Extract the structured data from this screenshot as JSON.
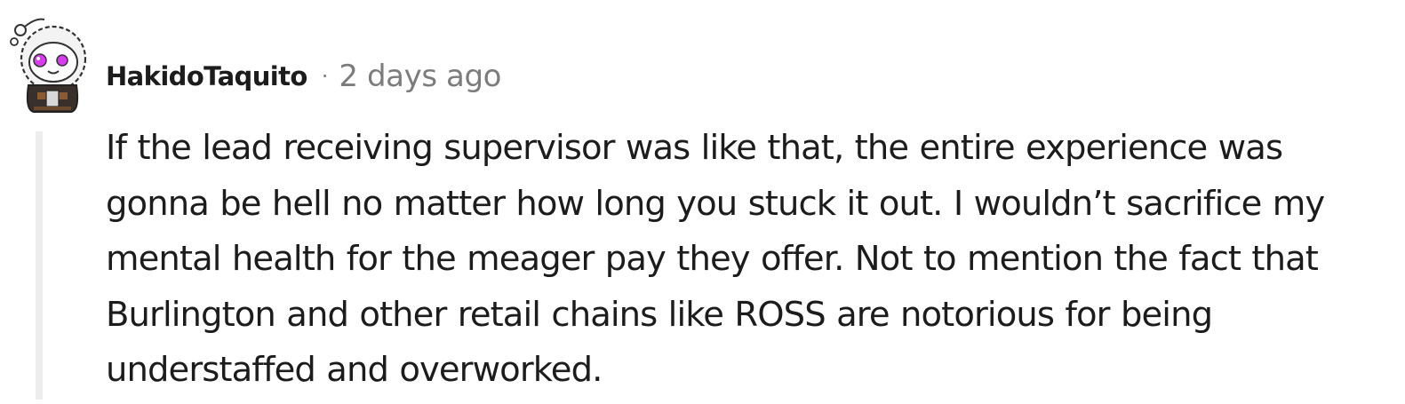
{
  "comment": {
    "author": "HakidoTaquito",
    "separator": "·",
    "timestamp": "2 days ago",
    "avatar_icon": "reddit-snoo-avatar-icon",
    "body_lines": [
      "If the lead receiving supervisor was like that, the entire experience was",
      "gonna be hell no matter how long you stuck it out. I wouldn’t sacrifice my",
      "mental health for the meager pay they offer. Not to mention the fact that",
      "Burlington and other retail chains like ROSS are notorious for being",
      "understaffed and overworked."
    ]
  },
  "colors": {
    "text": "#1c1c1c",
    "meta_text": "#7c7c7c",
    "thread_line": "#ededed",
    "avatar_eyes": "#d93cf0"
  }
}
